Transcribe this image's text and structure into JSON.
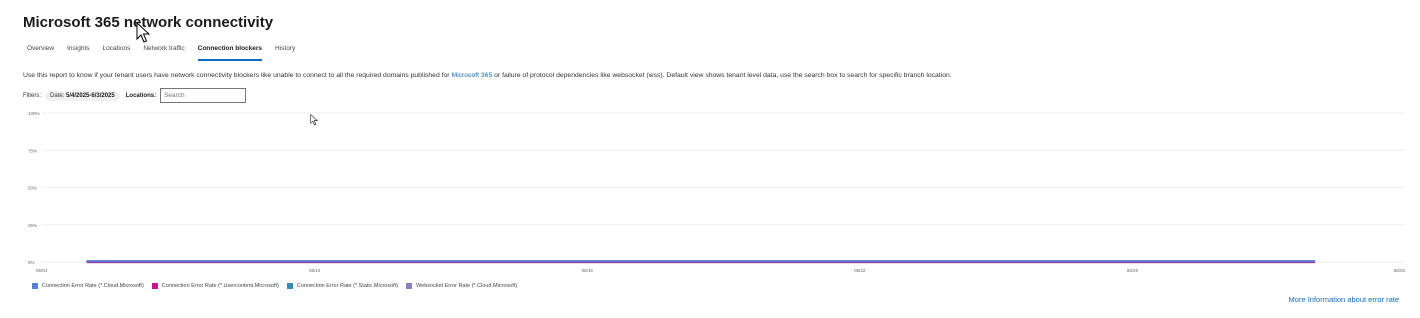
{
  "page": {
    "title": "Microsoft 365 network connectivity"
  },
  "tabs": [
    {
      "label": "Overview"
    },
    {
      "label": "Insights"
    },
    {
      "label": "Locations"
    },
    {
      "label": "Network traffic"
    },
    {
      "label": "Connection blockers",
      "active": true
    },
    {
      "label": "History"
    }
  ],
  "description": {
    "before": "Use this report to know if your tenant users have network connectivity blockers like unable to connect to all the required domains published for ",
    "link": "Microsoft 365",
    "after": " or failure of protocol dependencies like websocket (wss). Default view shows tenant level data, use the search box to search for specific branch location."
  },
  "filters": {
    "label": "Filters:",
    "date_prefix": "Date:",
    "date_value": "5/4/2025-6/3/2025",
    "locations_label": "Locations:",
    "search_placeholder": "Search"
  },
  "colors": {
    "accent": "#0f6cbd",
    "series_cloud": "#5b7fd6",
    "series_usercontent": "#c0178b",
    "series_static": "#2f8fb0",
    "series_websocket": "#8a80c8"
  },
  "chart_data": {
    "type": "line",
    "y_ticks": [
      "100%",
      "75%",
      "50%",
      "25%",
      "0%"
    ],
    "y_tick_values": [
      100,
      75,
      50,
      25,
      0
    ],
    "ylim": [
      0,
      100
    ],
    "x_ticks": [
      "05/04",
      "05/10",
      "05/16",
      "05/22",
      "05/28",
      "06/03"
    ],
    "x_range": [
      "2025-05-04",
      "2025-06-03"
    ],
    "grid": true,
    "legend_position": "bottom-left",
    "series": [
      {
        "name": "Connection Error Rate (*.Cloud.Microsoft)",
        "color": "#5b7fd6",
        "x_start": "2025-05-05",
        "x_end": "2025-06-01",
        "value": 0.5
      },
      {
        "name": "Connection Error Rate (*.Usercontent.Microsoft)",
        "color": "#c0178b",
        "x_start": "2025-05-05",
        "x_end": "2025-06-01",
        "value": 0
      },
      {
        "name": "Connection Error Rate (*.Static.Microsoft)",
        "color": "#2f8fb0",
        "x_start": "2025-05-05",
        "x_end": "2025-06-01",
        "value": 0
      },
      {
        "name": "Websocket Error Rate (*.Cloud.Microsoft)",
        "color": "#8a80c8",
        "x_start": "2025-05-05",
        "x_end": "2025-06-01",
        "value": 0.5
      }
    ]
  },
  "footer": {
    "more_info_link": "More Information about error rate"
  },
  "icons": {
    "cursor_main": "mouse-pointer-icon",
    "cursor_secondary": "mouse-pointer-icon"
  }
}
